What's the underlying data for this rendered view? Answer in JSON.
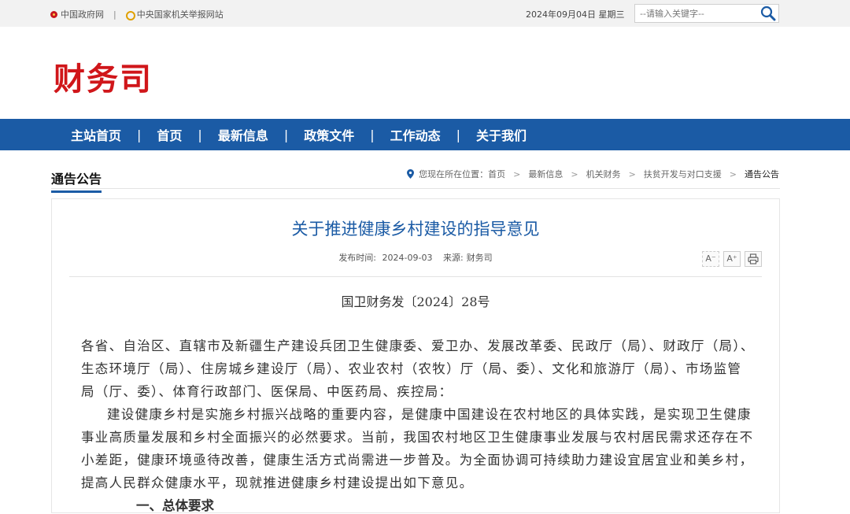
{
  "topbar": {
    "link_gov": "中国政府网",
    "separator": "|",
    "link_report": "中央国家机关举报网站",
    "date": "2024年09月04日 星期三",
    "search_placeholder": "--请输入关键字--"
  },
  "header": {
    "site_title": "财务司"
  },
  "nav": {
    "items": [
      "主站首页",
      "首页",
      "最新信息",
      "政策文件",
      "工作动态",
      "关于我们"
    ],
    "divider": "|"
  },
  "section": {
    "title": "通告公告"
  },
  "breadcrumb": {
    "prefix": "您现在所在位置：",
    "items": [
      "首页",
      "最新信息",
      "机关财务",
      "扶贫开发与对口支援"
    ],
    "current": "通告公告",
    "separator": ">"
  },
  "article": {
    "title": "关于推进健康乡村建设的指导意见",
    "publish_label": "发布时间:",
    "publish_date": "2024-09-03",
    "source_label": "来源:",
    "source": "财务司",
    "tools": {
      "font_smaller": "A⁻",
      "font_larger": "A⁺"
    },
    "doc_number": "国卫财务发〔2024〕28号",
    "salutation": "各省、自治区、直辖市及新疆生产建设兵团卫生健康委、爱卫办、发展改革委、民政厅（局）、财政厅（局）、生态环境厅（局）、住房城乡建设厅（局）、农业农村（农牧）厅（局、委）、文化和旅游厅（局）、市场监管局（厅、委）、体育行政部门、医保局、中医药局、疾控局：",
    "paragraph1": "建设健康乡村是实施乡村振兴战略的重要内容，是健康中国建设在农村地区的具体实践，是实现卫生健康事业高质量发展和乡村全面振兴的必然要求。当前，我国农村地区卫生健康事业发展与农村居民需求还存在不小差距，健康环境亟待改善，健康生活方式尚需进一步普及。为全面协调可持续助力建设宜居宜业和美乡村，提高人民群众健康水平，现就推进健康乡村建设提出如下意见。",
    "subhead": "一、总体要求"
  }
}
